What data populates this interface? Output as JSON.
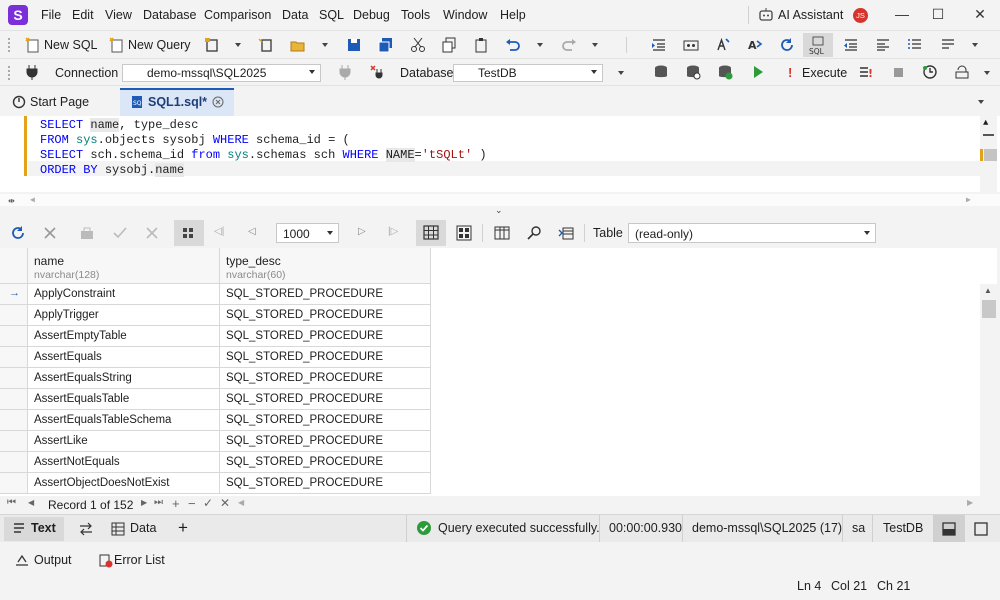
{
  "menu": [
    "File",
    "Edit",
    "View",
    "Database",
    "Comparison",
    "Data",
    "SQL",
    "Debug",
    "Tools",
    "Window",
    "Help"
  ],
  "ai_assistant": "AI Assistant",
  "user_initials": "JS",
  "toolbar1": {
    "new_sql": "New SQL",
    "new_query": "New Query"
  },
  "toolbar2": {
    "connection_label": "Connection",
    "connection_value": "demo-mssql\\SQL2025",
    "database_label": "Database",
    "database_value": "TestDB",
    "execute": "Execute"
  },
  "tabs": [
    {
      "label": "Start Page"
    },
    {
      "label": "SQL1.sql*"
    }
  ],
  "editor": {
    "lines": [
      [
        {
          "t": "SELECT ",
          "c": "kw"
        },
        {
          "t": "name",
          "c": "hl"
        },
        {
          "t": ", type_desc",
          "c": ""
        }
      ],
      [
        {
          "t": "FROM ",
          "c": "kw"
        },
        {
          "t": "sys",
          "c": "sys"
        },
        {
          "t": ".objects sysobj ",
          "c": ""
        },
        {
          "t": "WHERE",
          "c": "kw"
        },
        {
          "t": " schema_id = (",
          "c": ""
        }
      ],
      [
        {
          "t": "SELECT ",
          "c": "kw"
        },
        {
          "t": "sch.schema_id ",
          "c": ""
        },
        {
          "t": "from ",
          "c": "kw"
        },
        {
          "t": "sys",
          "c": "sys"
        },
        {
          "t": ".schemas sch ",
          "c": ""
        },
        {
          "t": "WHERE ",
          "c": "kw"
        },
        {
          "t": "NAME",
          "c": "hl"
        },
        {
          "t": "=",
          "c": ""
        },
        {
          "t": "'tSQLt'",
          "c": "str"
        },
        {
          "t": " )",
          "c": ""
        }
      ],
      [
        {
          "t": "ORDER BY ",
          "c": "kw"
        },
        {
          "t": "sysobj.",
          "c": ""
        },
        {
          "t": "name",
          "c": "hl"
        }
      ]
    ]
  },
  "gridtoolbar": {
    "page_size": "1000",
    "view_label": "Table",
    "view_value": "(read-only)"
  },
  "columns": [
    {
      "name": "name",
      "type": "nvarchar(128)"
    },
    {
      "name": "type_desc",
      "type": "nvarchar(60)"
    }
  ],
  "rows": [
    [
      "ApplyConstraint",
      "SQL_STORED_PROCEDURE"
    ],
    [
      "ApplyTrigger",
      "SQL_STORED_PROCEDURE"
    ],
    [
      "AssertEmptyTable",
      "SQL_STORED_PROCEDURE"
    ],
    [
      "AssertEquals",
      "SQL_STORED_PROCEDURE"
    ],
    [
      "AssertEqualsString",
      "SQL_STORED_PROCEDURE"
    ],
    [
      "AssertEqualsTable",
      "SQL_STORED_PROCEDURE"
    ],
    [
      "AssertEqualsTableSchema",
      "SQL_STORED_PROCEDURE"
    ],
    [
      "AssertLike",
      "SQL_STORED_PROCEDURE"
    ],
    [
      "AssertNotEquals",
      "SQL_STORED_PROCEDURE"
    ],
    [
      "AssertObjectDoesNotExist",
      "SQL_STORED_PROCEDURE"
    ]
  ],
  "navigator": {
    "record": "Record 1 of 152"
  },
  "status": {
    "text_tab": "Text",
    "data_tab": "Data",
    "message": "Query executed successfully.",
    "time": "00:00:00.930",
    "server": "demo-mssql\\SQL2025 (17)",
    "user": "sa",
    "database": "TestDB"
  },
  "bottom": {
    "output": "Output",
    "error_list": "Error List",
    "ln": "Ln 4",
    "col": "Col 21",
    "ch": "Ch 21"
  },
  "colors": {
    "accent": "#7b2fd8",
    "keyword": "#0000ff",
    "string": "#a31515",
    "success": "#2e9b3a"
  }
}
